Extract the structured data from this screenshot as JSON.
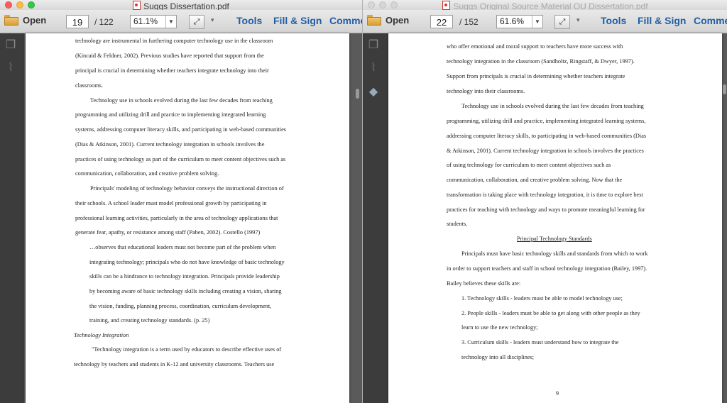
{
  "left_window": {
    "title": "Suggs Dissertation.pdf",
    "open_label": "Open",
    "page_current": "19",
    "page_total": "/ 122",
    "zoom": "61.1%",
    "tools_label": "Tools",
    "fill_sign_label": "Fill & Sign",
    "comment_label": "Comme",
    "lines": [
      "technology are instrumental in furthering computer technology use in the classroom",
      "(Kincaid & Feldner, 2002).  Previous studies have reported that support from the",
      "principal is crucial in determining whether teachers integrate technology into their",
      "classrooms.",
      "Technology use in schools evolved during the last few decades from teaching",
      "programming and utilizing drill and practice to implementing integrated learning",
      "systems, addressing computer literacy skills, and participating in web-based communities",
      "(Dias & Atkinson, 2001).  Current technology integration in schools involves the",
      "practices of using technology as part of the curriculum to meet content objectives such as",
      "communication, collaboration, and creative problem solving.",
      "Principals' modeling of technology behavior conveys the instructional direction of",
      "their schools.  A school leader must model professional growth by participating in",
      "professional learning activities, particularly in the area of technology applications that",
      "generate fear, apathy, or resistance among staff (Paben, 2002).  Costello (1997)",
      "…observes that educational leaders must not become part of the problem when",
      "integrating technology; principals who do not have knowledge of basic technology",
      "skills can be a hindrance to technology integration.  Principals provide leadership",
      "by becoming aware of basic technology skills including creating a vision, sharing",
      "the vision, funding, planning process, coordination, curriculum development,",
      "training, and creating technology standards. (p. 25)",
      "Technology Integration",
      "\"Technology integration is a term used by educators to describe effective uses of",
      "technology by teachers and students in K-12 and university classrooms.  Teachers use"
    ]
  },
  "right_window": {
    "title": "Suggs Original Source Material OU Dissertation.pdf",
    "open_label": "Open",
    "page_current": "22",
    "page_total": "/ 152",
    "zoom": "61.6%",
    "tools_label": "Tools",
    "fill_sign_label": "Fill & Sign",
    "comment_label": "Comme",
    "lines": [
      "who offer emotional and moral support to teachers have more success with",
      "technology integration in the classroom (Sandholtz, Ringstaff, & Dwyer, 1997).",
      "Support from principals is crucial in determining whether teachers integrate",
      "technology into their classrooms.",
      "Technology use in schools evolved during the last few decades from teaching",
      "programming, utilizing drill and practice, implementing integrated learning systems,",
      "addressing computer literacy skills, to participating in web-based communities (Dias",
      "& Atkinson, 2001).  Current technology integration in schools involves the practices",
      "of using technology for curriculum to meet content objectives such as",
      "communication, collaboration, and creative problem solving.  Now that the",
      "transformation is taking place with technology integration, it is time to explore best",
      "practices for teaching with technology and ways to promote meaningful learning for",
      "students.",
      "Principal Technology Standards",
      "Principals must have basic technology skills and standards from which to work",
      "in order to support teachers and staff in school technology integration (Bailey, 1997).",
      "Bailey believes these skills are:",
      "1.  Technology skills - leaders must be able to model technology use;",
      "2.  People skills - leaders must be able to get along with other people as they",
      "learn to use the new technology;",
      "3.  Curriculum skills - leaders must understand how to integrate the",
      "technology into all disciplines;"
    ],
    "page_number": "9"
  }
}
